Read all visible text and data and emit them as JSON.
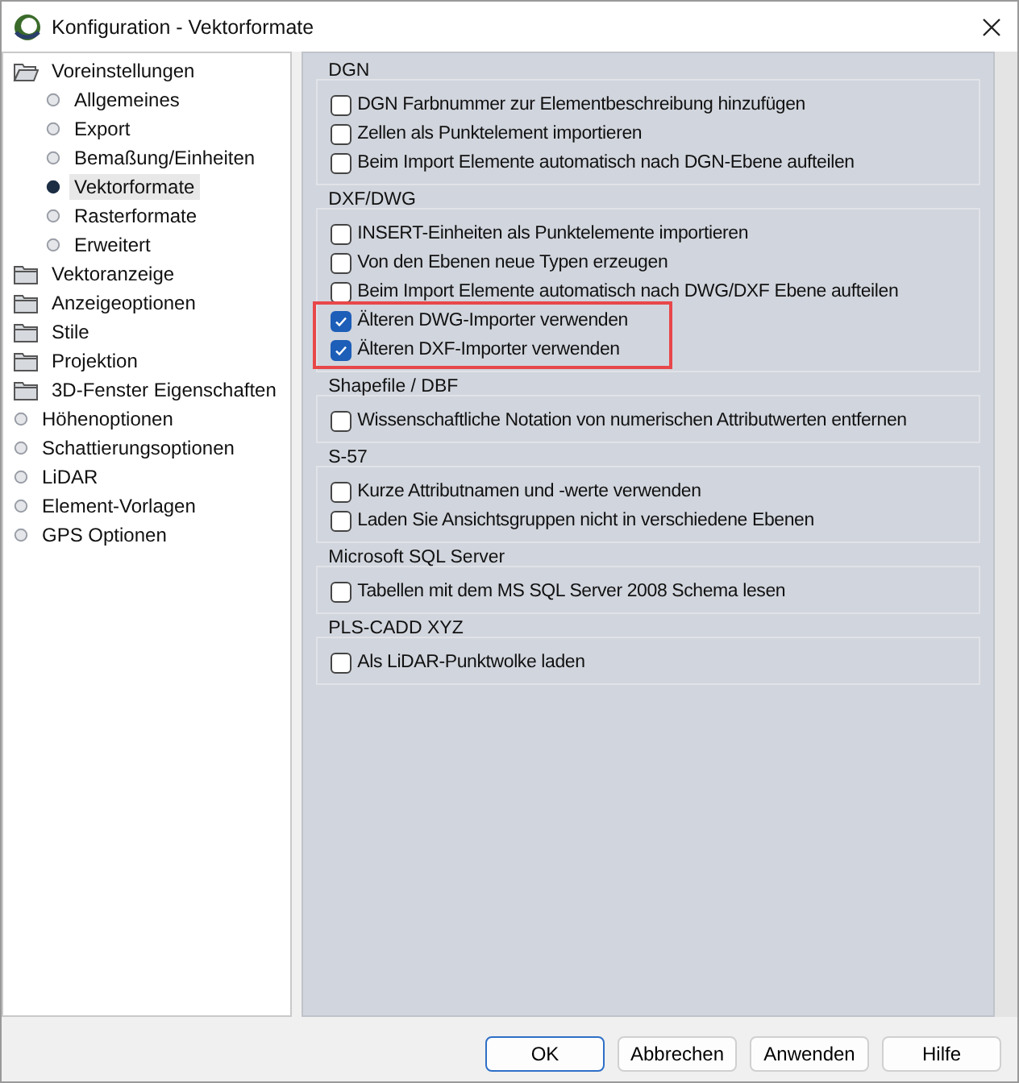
{
  "window": {
    "title": "Konfiguration - Vektorformate"
  },
  "sidebar": {
    "items": [
      {
        "label": "Voreinstellungen",
        "kind": "folder",
        "expanded": true,
        "selected": false,
        "children": [
          {
            "label": "Allgemeines",
            "kind": "leaf",
            "selected": false
          },
          {
            "label": "Export",
            "kind": "leaf",
            "selected": false
          },
          {
            "label": "Bemaßung/Einheiten",
            "kind": "leaf",
            "selected": false
          },
          {
            "label": "Vektorformate",
            "kind": "leaf",
            "selected": true
          },
          {
            "label": "Rasterformate",
            "kind": "leaf",
            "selected": false
          },
          {
            "label": "Erweitert",
            "kind": "leaf",
            "selected": false
          }
        ]
      },
      {
        "label": "Vektoranzeige",
        "kind": "folder",
        "expanded": false,
        "selected": false
      },
      {
        "label": "Anzeigeoptionen",
        "kind": "folder",
        "expanded": false,
        "selected": false
      },
      {
        "label": "Stile",
        "kind": "folder",
        "expanded": false,
        "selected": false
      },
      {
        "label": "Projektion",
        "kind": "folder",
        "expanded": false,
        "selected": false
      },
      {
        "label": "3D-Fenster Eigenschaften",
        "kind": "folder",
        "expanded": false,
        "selected": false
      },
      {
        "label": "Höhenoptionen",
        "kind": "leaf",
        "selected": false
      },
      {
        "label": "Schattierungsoptionen",
        "kind": "leaf",
        "selected": false
      },
      {
        "label": "LiDAR",
        "kind": "leaf",
        "selected": false
      },
      {
        "label": "Element-Vorlagen",
        "kind": "leaf",
        "selected": false
      },
      {
        "label": "GPS Optionen",
        "kind": "leaf",
        "selected": false
      }
    ]
  },
  "groups": [
    {
      "title": "DGN",
      "options": [
        {
          "label": "DGN Farbnummer zur Elementbeschreibung hinzufügen",
          "checked": false
        },
        {
          "label": "Zellen als Punktelement importieren",
          "checked": false
        },
        {
          "label": "Beim Import Elemente automatisch nach DGN-Ebene aufteilen",
          "checked": false
        }
      ]
    },
    {
      "title": "DXF/DWG",
      "options": [
        {
          "label": "INSERT-Einheiten als Punktelemente importieren",
          "checked": false
        },
        {
          "label": "Von den Ebenen neue Typen erzeugen",
          "checked": false
        },
        {
          "label": "Beim Import Elemente automatisch nach DWG/DXF Ebene aufteilen",
          "checked": false
        },
        {
          "label": "Älteren DWG-Importer verwenden",
          "checked": true
        },
        {
          "label": "Älteren DXF-Importer verwenden",
          "checked": true
        }
      ]
    },
    {
      "title": "Shapefile / DBF",
      "options": [
        {
          "label": "Wissenschaftliche Notation von numerischen Attributwerten entfernen",
          "checked": false
        }
      ]
    },
    {
      "title": "S-57",
      "options": [
        {
          "label": "Kurze Attributnamen und -werte verwenden",
          "checked": false
        },
        {
          "label": "Laden Sie Ansichtsgruppen nicht in verschiedene Ebenen",
          "checked": false
        }
      ]
    },
    {
      "title": "Microsoft SQL Server",
      "options": [
        {
          "label": "Tabellen mit dem MS SQL Server 2008 Schema lesen",
          "checked": false
        }
      ]
    },
    {
      "title": "PLS-CADD XYZ",
      "options": [
        {
          "label": "Als LiDAR-Punktwolke laden",
          "checked": false
        }
      ]
    }
  ],
  "buttons": [
    {
      "label": "OK",
      "default": true
    },
    {
      "label": "Abbrechen",
      "default": false
    },
    {
      "label": "Anwenden",
      "default": false
    },
    {
      "label": "Hilfe",
      "default": false
    }
  ]
}
